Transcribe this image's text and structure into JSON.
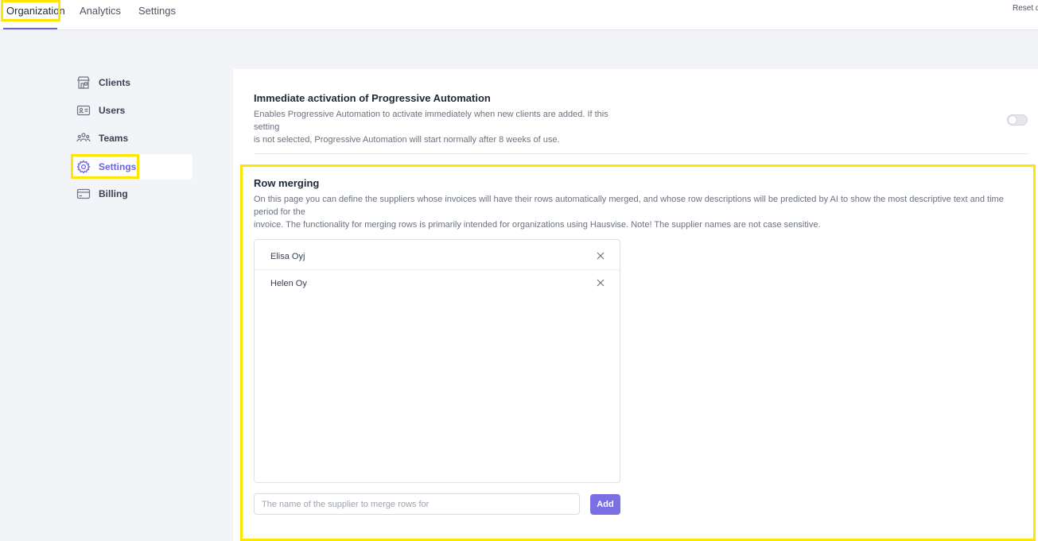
{
  "topnav": {
    "tabs": [
      {
        "label": "Organization",
        "active": true
      },
      {
        "label": "Analytics",
        "active": false
      },
      {
        "label": "Settings",
        "active": false
      }
    ],
    "reset_label": "Reset defaults"
  },
  "sidebar": {
    "items": [
      {
        "label": "Clients",
        "icon": "store-icon",
        "active": false
      },
      {
        "label": "Users",
        "icon": "id-card-icon",
        "active": false
      },
      {
        "label": "Teams",
        "icon": "team-icon",
        "active": false
      },
      {
        "label": "Settings",
        "icon": "gear-icon",
        "active": true
      },
      {
        "label": "Billing",
        "icon": "credit-card-icon",
        "active": false
      }
    ]
  },
  "progressive": {
    "title": "Immediate activation of Progressive Automation",
    "description_line1": "Enables Progressive Automation to activate immediately when new clients are added. If this setting",
    "description_line2": "is not selected, Progressive Automation will start normally after 8 weeks of use.",
    "toggle_on": false
  },
  "row_merging": {
    "title": "Row merging",
    "description_line1": "On this page you can define the suppliers whose invoices will have their rows automatically merged, and whose row descriptions will be predicted by AI to show the most descriptive text and time period for the",
    "description_line2": "invoice. The functionality for merging rows is primarily intended for organizations using Hausvise. Note! The supplier names are not case sensitive.",
    "suppliers": [
      "Elisa Oyj",
      "Helen Oy"
    ],
    "input_placeholder": "The name of the supplier to merge rows for",
    "add_label": "Add"
  },
  "colors": {
    "accent": "#6c63e0",
    "button": "#7b6fe6",
    "highlight": "#ffe500",
    "background": "#f3f4f8"
  }
}
